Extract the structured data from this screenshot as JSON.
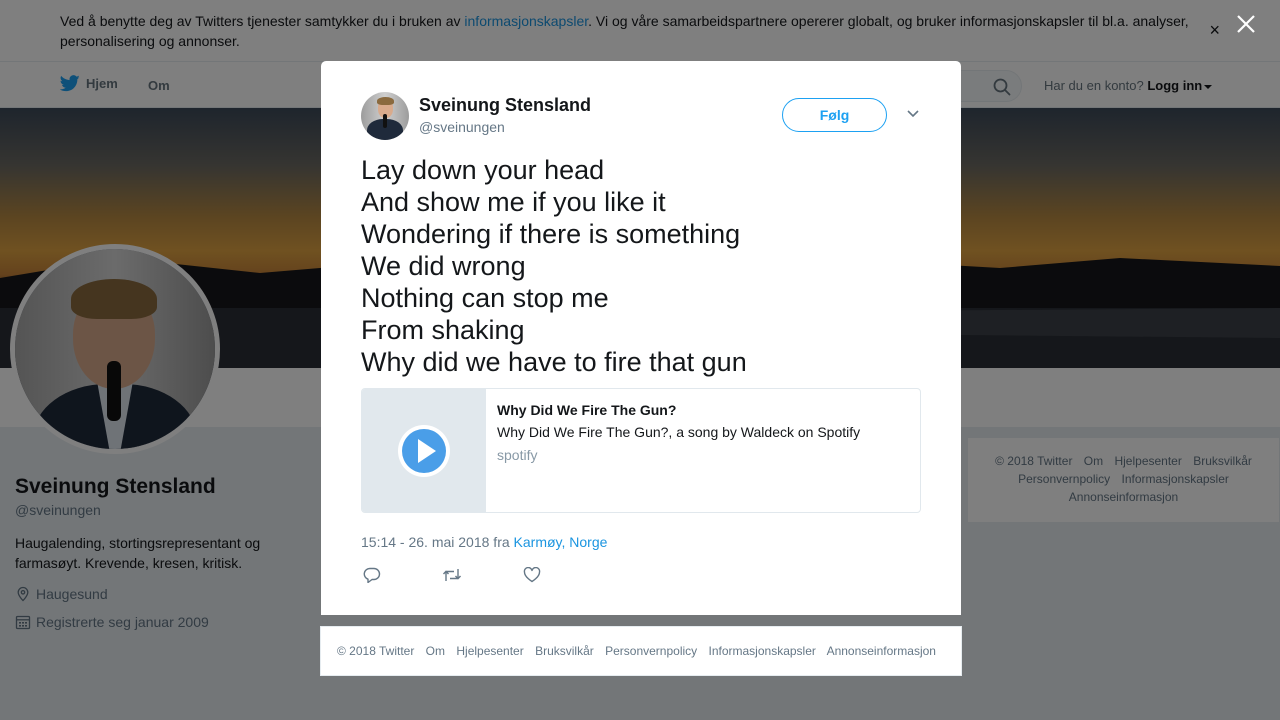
{
  "cookie_bar": {
    "text_before": "Ved å benytte deg av Twitters tjenester samtykker du i bruken av ",
    "link": "informasjonskapsler",
    "text_after": ". Vi og våre samarbeidspartnere opererer globalt, og bruker informasjonskapsler til bl.a. analyser, personalisering og annonser.",
    "close": "×"
  },
  "nav": {
    "home": "Hjem",
    "about": "Om",
    "have_account": "Har du en konto?",
    "login": "Logg inn"
  },
  "profile": {
    "name": "Sveinung Stensland",
    "handle": "@sveinungen",
    "bio": "Haugalending, stortingsrepresentant og farmasøyt. Krevende, kresen, kritisk.",
    "location": "Haugesund",
    "joined": "Registrerte seg januar 2009"
  },
  "side_footer": {
    "items": [
      "© 2018 Twitter",
      "Om",
      "Hjelpesenter",
      "Bruksvilkår",
      "Personvernpolicy",
      "Informasjonskapsler",
      "Annonseinformasjon"
    ]
  },
  "modal": {
    "name": "Sveinung Stensland",
    "handle": "@sveinungen",
    "follow": "Følg",
    "text": "Lay down your head\nAnd show me if you like it\nWondering if there is something\nWe did wrong\nNothing can stop me\nFrom shaking\nWhy did we have to fire that gun",
    "card": {
      "title": "Why Did We Fire The Gun?",
      "description": "Why Did We Fire The Gun?, a song by Waldeck on Spotify",
      "domain": "spotify"
    },
    "time": "15:14 - 26. mai 2018 fra ",
    "place": "Karmøy, Norge"
  },
  "modal_footer": {
    "items": [
      "© 2018 Twitter",
      "Om",
      "Hjelpesenter",
      "Bruksvilkår",
      "Personvernpolicy",
      "Informasjonskapsler",
      "Annonseinformasjon"
    ]
  },
  "colors": {
    "twitter_blue": "#1da1f2",
    "link_blue": "#1b95e0",
    "overlay": "rgba(0,0,0,0.5)"
  }
}
